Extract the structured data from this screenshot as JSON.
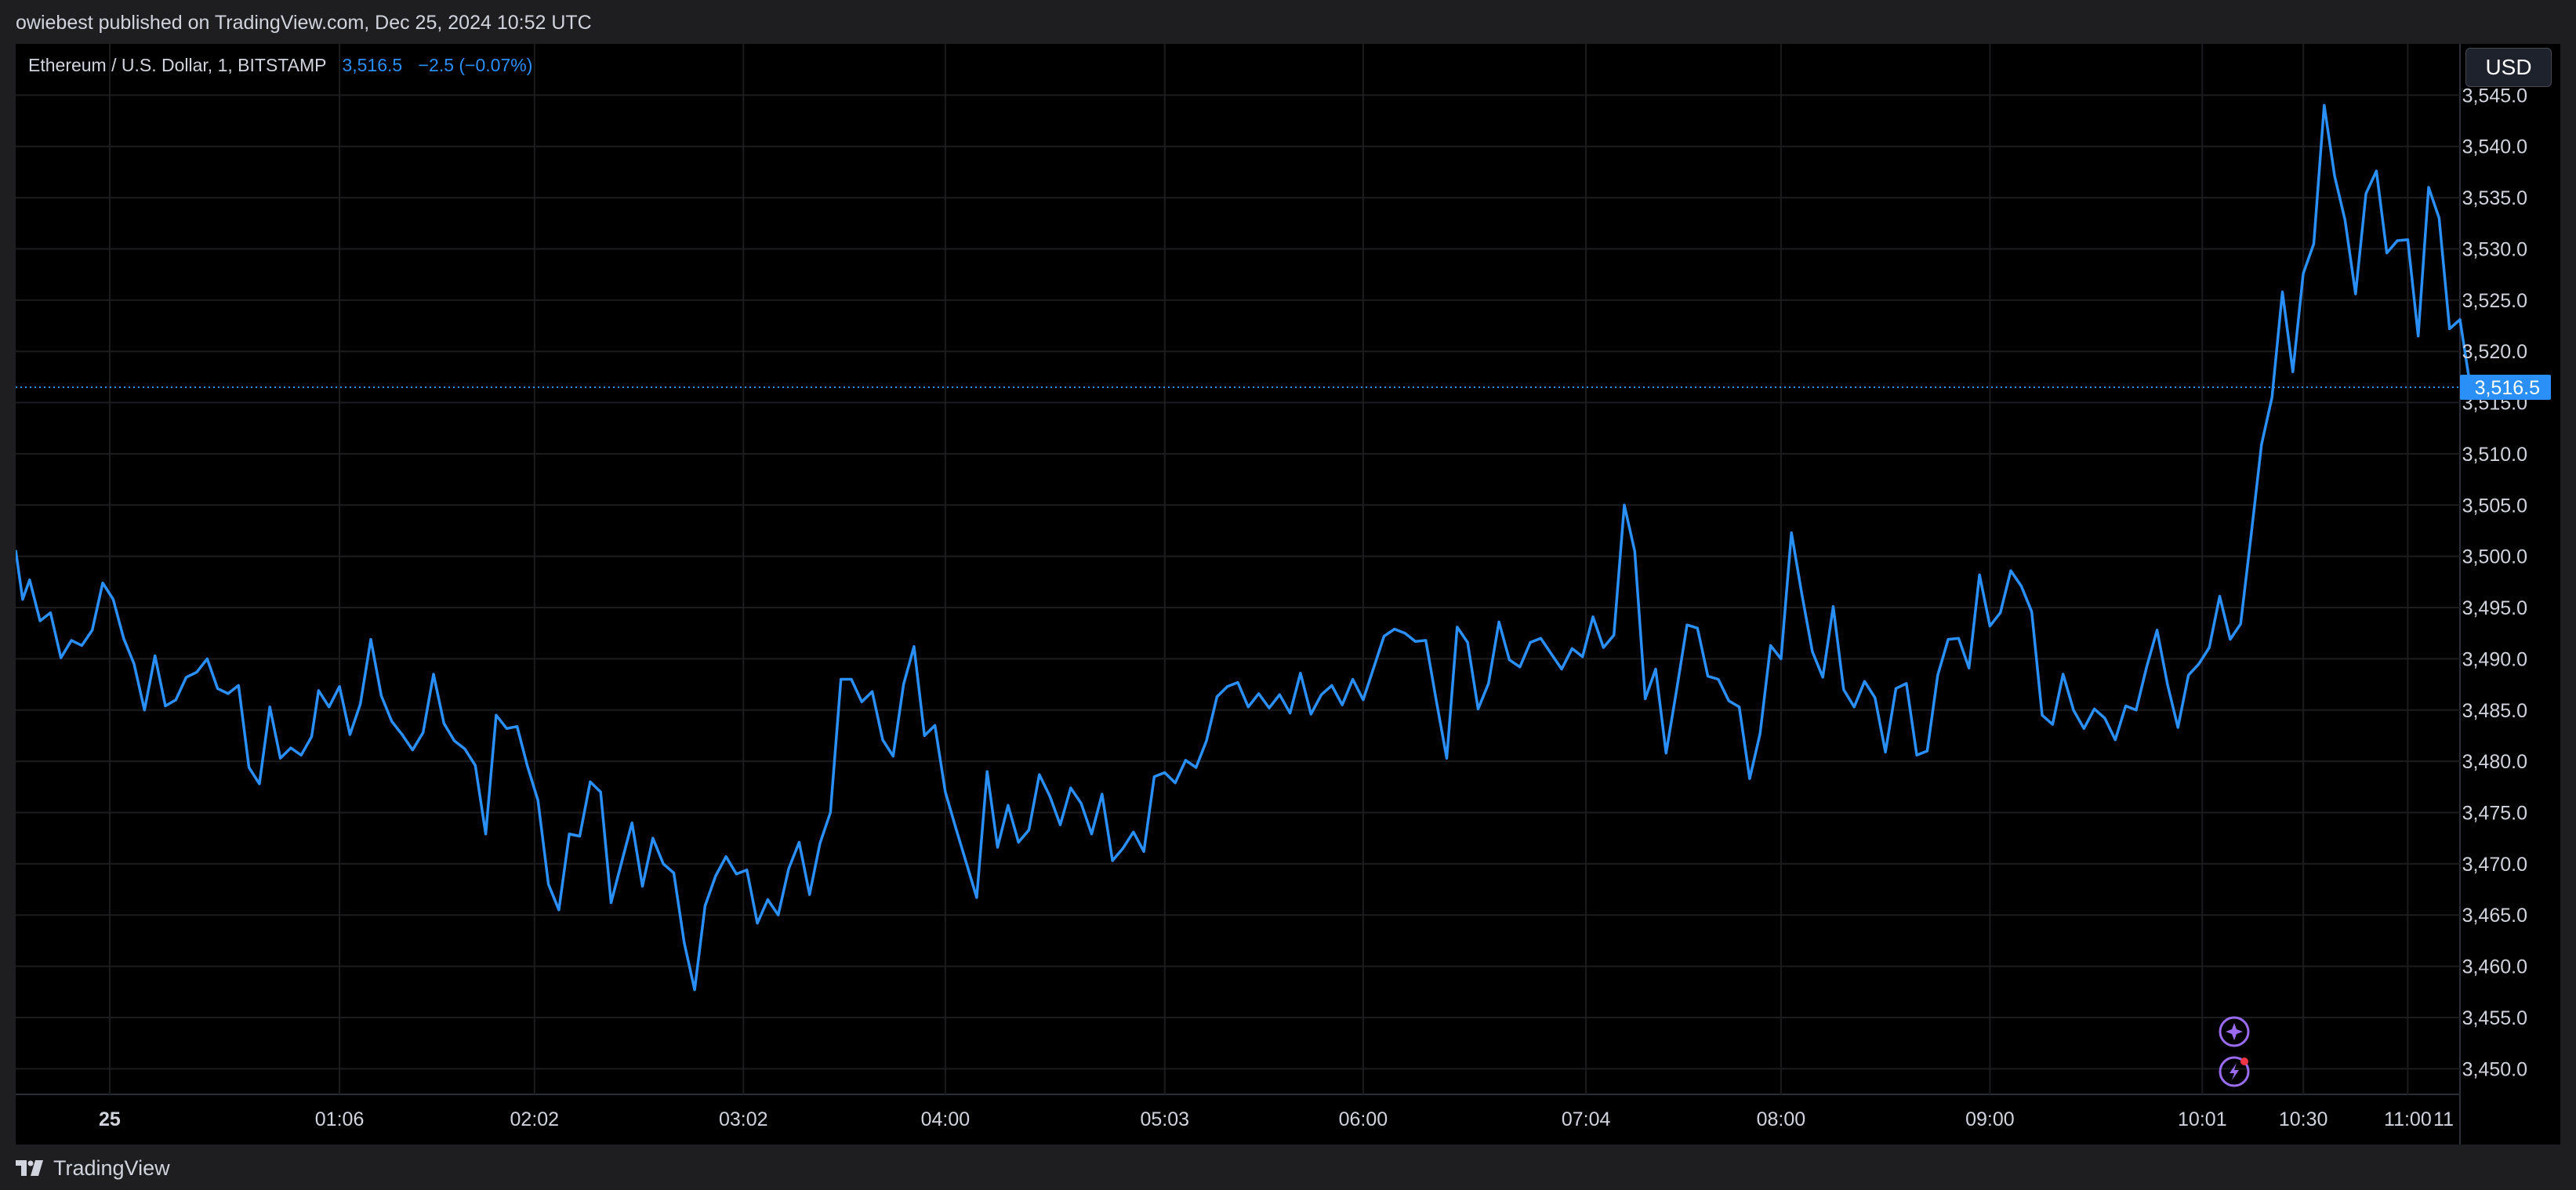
{
  "header": {
    "published_by": "owiebest published on TradingView.com, Dec 25, 2024 10:52 UTC"
  },
  "legend": {
    "symbol": "Ethereum / U.S. Dollar, 1, BITSTAMP",
    "last_price": "3,516.5",
    "change": "−2.5 (−0.07%)"
  },
  "currency_button": {
    "label": "USD"
  },
  "footer": {
    "brand": "TradingView"
  },
  "colors": {
    "line": "#2a8ff7",
    "background": "#000000",
    "panel": "#1e1e21",
    "grid": "#1c1c1f",
    "accent_icon": "#9b6cf2",
    "badge_dot": "#f23645"
  },
  "chart_data": {
    "type": "line",
    "title": "Ethereum / U.S. Dollar, 1, BITSTAMP",
    "xlabel": "",
    "ylabel": "",
    "ylim": [
      3447.5,
      3550
    ],
    "xlim": [
      "2024-12-25 00:00",
      "2024-12-25 11:15"
    ],
    "y_ticks": [
      3450,
      3455,
      3460,
      3465,
      3470,
      3475,
      3480,
      3485,
      3490,
      3495,
      3500,
      3505,
      3510,
      3515,
      3520,
      3525,
      3530,
      3535,
      3540,
      3545
    ],
    "y_tick_labels": [
      "3,450.0",
      "3,455.0",
      "3,460.0",
      "3,465.0",
      "3,470.0",
      "3,475.0",
      "3,480.0",
      "3,485.0",
      "3,490.0",
      "3,495.0",
      "3,500.0",
      "3,505.0",
      "3,510.0",
      "3,515.0",
      "3,520.0",
      "3,525.0",
      "3,530.0",
      "3,535.0",
      "3,540.0",
      "3,545.0"
    ],
    "x_ticks": [
      {
        "label": "25",
        "time": "00:00"
      },
      {
        "label": "01:06",
        "time": "01:06"
      },
      {
        "label": "02:02",
        "time": "02:02"
      },
      {
        "label": "03:02",
        "time": "03:02"
      },
      {
        "label": "04:00",
        "time": "04:00"
      },
      {
        "label": "05:03",
        "time": "05:03"
      },
      {
        "label": "06:00",
        "time": "06:00"
      },
      {
        "label": "07:04",
        "time": "07:04"
      },
      {
        "label": "08:00",
        "time": "08:00"
      },
      {
        "label": "09:00",
        "time": "09:00"
      },
      {
        "label": "10:01",
        "time": "10:01"
      },
      {
        "label": "10:30",
        "time": "10:30"
      },
      {
        "label": "11:00",
        "time": "11:00"
      },
      {
        "label": "11",
        "time": "11:15"
      }
    ],
    "last_price_label": "3,516.5",
    "last_price": 3516.5,
    "grid": true,
    "series": [
      {
        "values": [
          [
            "23:33",
            3500.6
          ],
          [
            "23:35",
            3495.8
          ],
          [
            "23:37",
            3497.7
          ],
          [
            "23:40",
            3493.7
          ],
          [
            "23:43",
            3494.5
          ],
          [
            "23:46",
            3490.1
          ],
          [
            "23:49",
            3491.8
          ],
          [
            "23:52",
            3491.3
          ],
          [
            "23:55",
            3492.8
          ],
          [
            "23:58",
            3497.4
          ],
          [
            "00:01",
            3495.8
          ],
          [
            "00:04",
            3492.0
          ],
          [
            "00:07",
            3489.5
          ],
          [
            "00:10",
            3485.0
          ],
          [
            "00:13",
            3490.3
          ],
          [
            "00:16",
            3485.4
          ],
          [
            "00:19",
            3486.0
          ],
          [
            "00:22",
            3488.2
          ],
          [
            "00:25",
            3488.7
          ],
          [
            "00:28",
            3490.0
          ],
          [
            "00:31",
            3487.1
          ],
          [
            "00:34",
            3486.6
          ],
          [
            "00:37",
            3487.4
          ],
          [
            "00:40",
            3479.4
          ],
          [
            "00:43",
            3477.8
          ],
          [
            "00:46",
            3485.3
          ],
          [
            "00:49",
            3480.3
          ],
          [
            "00:52",
            3481.3
          ],
          [
            "00:55",
            3480.6
          ],
          [
            "00:58",
            3482.4
          ],
          [
            "01:00",
            3486.9
          ],
          [
            "01:03",
            3485.3
          ],
          [
            "01:06",
            3487.3
          ],
          [
            "01:09",
            3482.6
          ],
          [
            "01:12",
            3485.6
          ],
          [
            "01:15",
            3491.9
          ],
          [
            "01:18",
            3486.4
          ],
          [
            "01:21",
            3483.9
          ],
          [
            "01:24",
            3482.6
          ],
          [
            "01:27",
            3481.1
          ],
          [
            "01:30",
            3482.8
          ],
          [
            "01:33",
            3488.5
          ],
          [
            "01:36",
            3483.7
          ],
          [
            "01:39",
            3482.0
          ],
          [
            "01:42",
            3481.2
          ],
          [
            "01:45",
            3479.6
          ],
          [
            "01:48",
            3472.9
          ],
          [
            "01:51",
            3484.5
          ],
          [
            "01:54",
            3483.2
          ],
          [
            "01:57",
            3483.4
          ],
          [
            "02:00",
            3479.5
          ],
          [
            "02:03",
            3476.2
          ],
          [
            "02:06",
            3468.0
          ],
          [
            "02:09",
            3465.5
          ],
          [
            "02:12",
            3472.9
          ],
          [
            "02:15",
            3472.7
          ],
          [
            "02:18",
            3478.0
          ],
          [
            "02:21",
            3477.0
          ],
          [
            "02:24",
            3466.2
          ],
          [
            "02:27",
            3470.1
          ],
          [
            "02:30",
            3474.0
          ],
          [
            "02:33",
            3467.8
          ],
          [
            "02:36",
            3472.5
          ],
          [
            "02:39",
            3470.0
          ],
          [
            "02:42",
            3469.1
          ],
          [
            "02:45",
            3462.3
          ],
          [
            "02:48",
            3457.7
          ],
          [
            "02:51",
            3465.9
          ],
          [
            "02:54",
            3468.8
          ],
          [
            "02:57",
            3470.7
          ],
          [
            "03:00",
            3469.0
          ],
          [
            "03:03",
            3469.4
          ],
          [
            "03:06",
            3464.2
          ],
          [
            "03:09",
            3466.5
          ],
          [
            "03:12",
            3465.0
          ],
          [
            "03:15",
            3469.5
          ],
          [
            "03:18",
            3472.1
          ],
          [
            "03:21",
            3467.0
          ],
          [
            "03:24",
            3472.0
          ],
          [
            "03:27",
            3475.0
          ],
          [
            "03:30",
            3488.0
          ],
          [
            "03:33",
            3488.0
          ],
          [
            "03:36",
            3485.8
          ],
          [
            "03:39",
            3486.8
          ],
          [
            "03:42",
            3482.1
          ],
          [
            "03:45",
            3480.5
          ],
          [
            "03:48",
            3487.5
          ],
          [
            "03:51",
            3491.2
          ],
          [
            "03:54",
            3482.5
          ],
          [
            "03:57",
            3483.5
          ],
          [
            "04:00",
            3477.0
          ],
          [
            "04:03",
            3473.5
          ],
          [
            "04:06",
            3470.1
          ],
          [
            "04:09",
            3466.7
          ],
          [
            "04:12",
            3479.0
          ],
          [
            "04:15",
            3471.6
          ],
          [
            "04:18",
            3475.7
          ],
          [
            "04:21",
            3472.1
          ],
          [
            "04:24",
            3473.3
          ],
          [
            "04:27",
            3478.7
          ],
          [
            "04:30",
            3476.6
          ],
          [
            "04:33",
            3473.8
          ],
          [
            "04:36",
            3477.4
          ],
          [
            "04:39",
            3475.9
          ],
          [
            "04:42",
            3472.9
          ],
          [
            "04:45",
            3476.8
          ],
          [
            "04:48",
            3470.3
          ],
          [
            "04:51",
            3471.5
          ],
          [
            "04:54",
            3473.1
          ],
          [
            "04:57",
            3471.2
          ],
          [
            "05:00",
            3478.5
          ],
          [
            "05:03",
            3478.9
          ],
          [
            "05:06",
            3477.9
          ],
          [
            "05:09",
            3480.1
          ],
          [
            "05:12",
            3479.4
          ],
          [
            "05:15",
            3482.0
          ],
          [
            "05:18",
            3486.3
          ],
          [
            "05:21",
            3487.3
          ],
          [
            "05:24",
            3487.7
          ],
          [
            "05:27",
            3485.3
          ],
          [
            "05:30",
            3486.6
          ],
          [
            "05:33",
            3485.2
          ],
          [
            "05:36",
            3486.5
          ],
          [
            "05:39",
            3484.7
          ],
          [
            "05:42",
            3488.6
          ],
          [
            "05:45",
            3484.6
          ],
          [
            "05:48",
            3486.5
          ],
          [
            "05:51",
            3487.4
          ],
          [
            "05:54",
            3485.5
          ],
          [
            "05:57",
            3488.0
          ],
          [
            "06:00",
            3486.0
          ],
          [
            "06:03",
            3489.1
          ],
          [
            "06:06",
            3492.2
          ],
          [
            "06:09",
            3492.9
          ],
          [
            "06:12",
            3492.5
          ],
          [
            "06:15",
            3491.7
          ],
          [
            "06:18",
            3491.8
          ],
          [
            "06:21",
            3485.9
          ],
          [
            "06:24",
            3480.3
          ],
          [
            "06:27",
            3493.1
          ],
          [
            "06:30",
            3491.6
          ],
          [
            "06:33",
            3485.1
          ],
          [
            "06:36",
            3487.6
          ],
          [
            "06:39",
            3493.6
          ],
          [
            "06:42",
            3489.9
          ],
          [
            "06:45",
            3489.2
          ],
          [
            "06:48",
            3491.6
          ],
          [
            "06:51",
            3492.0
          ],
          [
            "06:54",
            3490.5
          ],
          [
            "06:57",
            3489.0
          ],
          [
            "07:00",
            3491.0
          ],
          [
            "07:03",
            3490.2
          ],
          [
            "07:06",
            3494.1
          ],
          [
            "07:09",
            3491.1
          ],
          [
            "07:12",
            3492.3
          ],
          [
            "07:15",
            3505.0
          ],
          [
            "07:18",
            3500.5
          ],
          [
            "07:21",
            3486.1
          ],
          [
            "07:24",
            3489.0
          ],
          [
            "07:27",
            3480.8
          ],
          [
            "07:30",
            3486.9
          ],
          [
            "07:33",
            3493.3
          ],
          [
            "07:36",
            3493.0
          ],
          [
            "07:39",
            3488.3
          ],
          [
            "07:42",
            3488.0
          ],
          [
            "07:45",
            3485.9
          ],
          [
            "07:48",
            3485.3
          ],
          [
            "07:51",
            3478.3
          ],
          [
            "07:54",
            3482.7
          ],
          [
            "07:57",
            3491.3
          ],
          [
            "08:00",
            3490.0
          ],
          [
            "08:03",
            3502.3
          ],
          [
            "08:06",
            3496.3
          ],
          [
            "08:09",
            3490.7
          ],
          [
            "08:12",
            3488.2
          ],
          [
            "08:15",
            3495.1
          ],
          [
            "08:18",
            3487.0
          ],
          [
            "08:21",
            3485.3
          ],
          [
            "08:24",
            3487.8
          ],
          [
            "08:27",
            3486.2
          ],
          [
            "08:30",
            3480.9
          ],
          [
            "08:33",
            3487.1
          ],
          [
            "08:36",
            3487.6
          ],
          [
            "08:39",
            3480.6
          ],
          [
            "08:42",
            3481.0
          ],
          [
            "08:45",
            3488.4
          ],
          [
            "08:48",
            3491.9
          ],
          [
            "08:51",
            3492.0
          ],
          [
            "08:54",
            3489.1
          ],
          [
            "08:57",
            3498.2
          ],
          [
            "09:00",
            3493.2
          ],
          [
            "09:03",
            3494.5
          ],
          [
            "09:06",
            3498.6
          ],
          [
            "09:09",
            3497.1
          ],
          [
            "09:12",
            3494.6
          ],
          [
            "09:15",
            3484.5
          ],
          [
            "09:18",
            3483.6
          ],
          [
            "09:21",
            3488.5
          ],
          [
            "09:24",
            3485.0
          ],
          [
            "09:27",
            3483.2
          ],
          [
            "09:30",
            3485.1
          ],
          [
            "09:33",
            3484.2
          ],
          [
            "09:36",
            3482.1
          ],
          [
            "09:39",
            3485.4
          ],
          [
            "09:42",
            3485.0
          ],
          [
            "09:45",
            3489.2
          ],
          [
            "09:48",
            3492.8
          ],
          [
            "09:51",
            3487.5
          ],
          [
            "09:54",
            3483.3
          ],
          [
            "09:57",
            3488.4
          ],
          [
            "10:00",
            3489.5
          ],
          [
            "10:03",
            3491.1
          ],
          [
            "10:06",
            3496.1
          ],
          [
            "10:09",
            3491.9
          ],
          [
            "10:12",
            3493.4
          ],
          [
            "10:15",
            3502.0
          ],
          [
            "10:18",
            3510.9
          ],
          [
            "10:21",
            3515.5
          ],
          [
            "10:24",
            3525.8
          ],
          [
            "10:27",
            3518.0
          ],
          [
            "10:30",
            3527.6
          ],
          [
            "10:33",
            3530.5
          ],
          [
            "10:36",
            3544.0
          ],
          [
            "10:39",
            3537.1
          ],
          [
            "10:42",
            3532.8
          ],
          [
            "10:45",
            3525.6
          ],
          [
            "10:48",
            3535.4
          ],
          [
            "10:51",
            3537.6
          ],
          [
            "10:54",
            3529.6
          ],
          [
            "10:57",
            3530.8
          ],
          [
            "11:00",
            3530.9
          ],
          [
            "11:03",
            3521.5
          ],
          [
            "11:06",
            3536.0
          ],
          [
            "11:09",
            3533.0
          ],
          [
            "11:12",
            3522.2
          ],
          [
            "11:15",
            3523.1
          ],
          [
            "11:18",
            3516.5
          ]
        ]
      }
    ]
  }
}
